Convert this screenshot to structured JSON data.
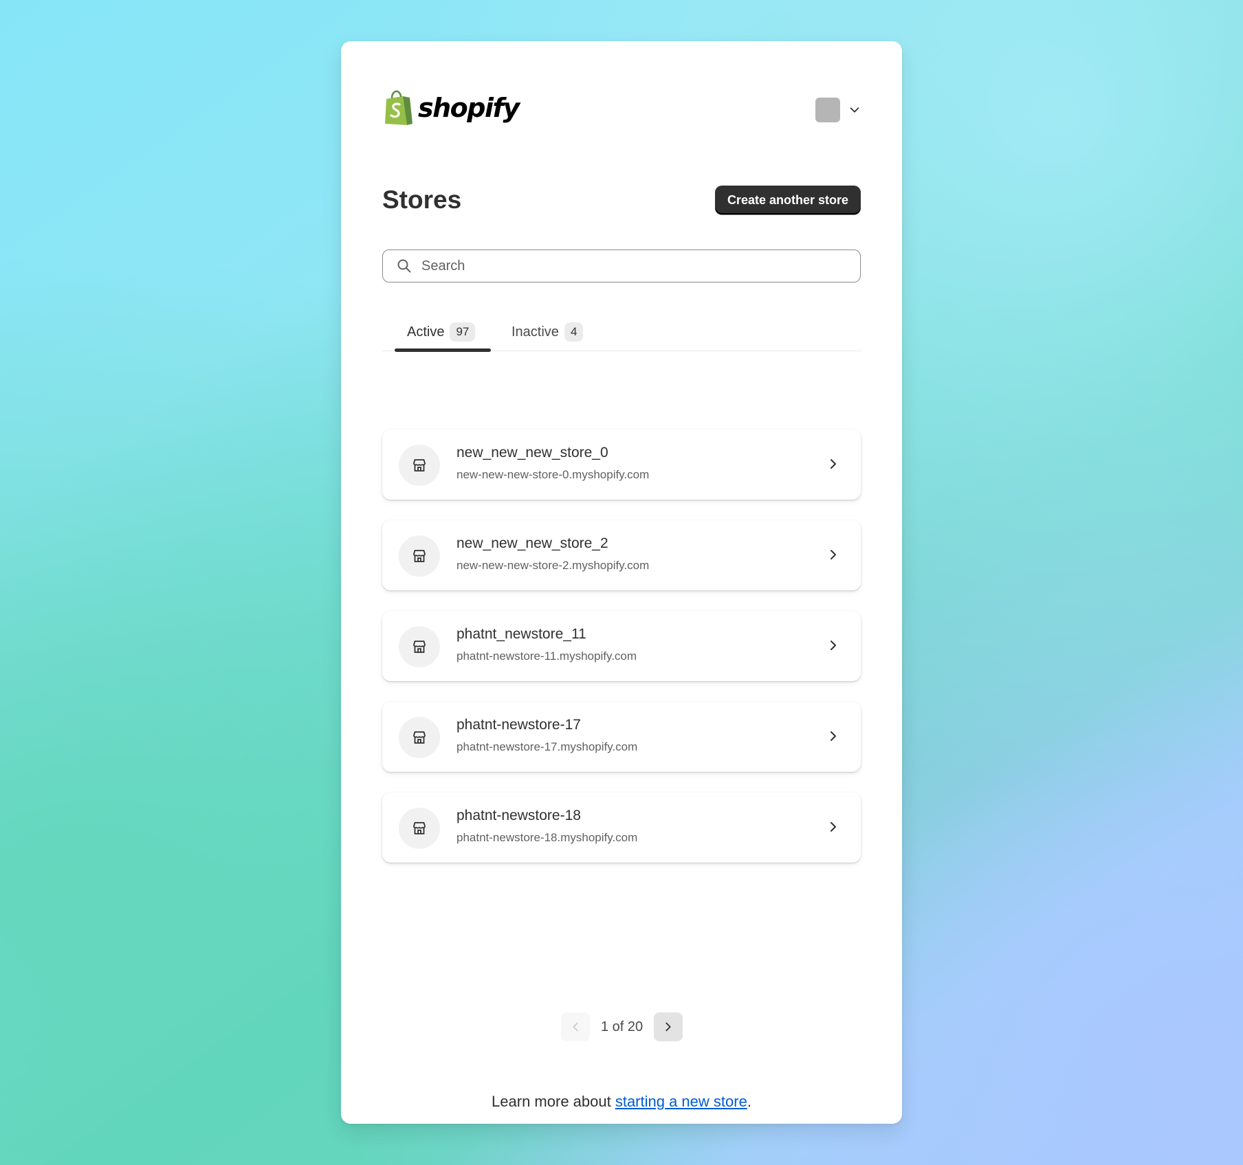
{
  "brand": {
    "name": "shopify",
    "bag_color": "#95bf47",
    "bag_dark": "#5e8e3e"
  },
  "header": {
    "account_avatar_color": "#b5b5b5"
  },
  "page": {
    "title": "Stores",
    "create_button": "Create another store"
  },
  "search": {
    "placeholder": "Search",
    "value": ""
  },
  "tabs": [
    {
      "label": "Active",
      "count": "97",
      "selected": true
    },
    {
      "label": "Inactive",
      "count": "4",
      "selected": false
    }
  ],
  "stores": [
    {
      "name": "new_new_new_store_0",
      "url": "new-new-new-store-0.myshopify.com"
    },
    {
      "name": "new_new_new_store_2",
      "url": "new-new-new-store-2.myshopify.com"
    },
    {
      "name": "phatnt_newstore_11",
      "url": "phatnt-newstore-11.myshopify.com"
    },
    {
      "name": "phatnt-newstore-17",
      "url": "phatnt-newstore-17.myshopify.com"
    },
    {
      "name": "phatnt-newstore-18",
      "url": "phatnt-newstore-18.myshopify.com"
    }
  ],
  "pagination": {
    "label": "1 of 20",
    "prev_enabled": false,
    "next_enabled": true
  },
  "footer": {
    "prefix": "Learn more about ",
    "link_text": "starting a new store",
    "suffix": "."
  },
  "colors": {
    "primary_button": "#303030",
    "link": "#005bd3"
  }
}
